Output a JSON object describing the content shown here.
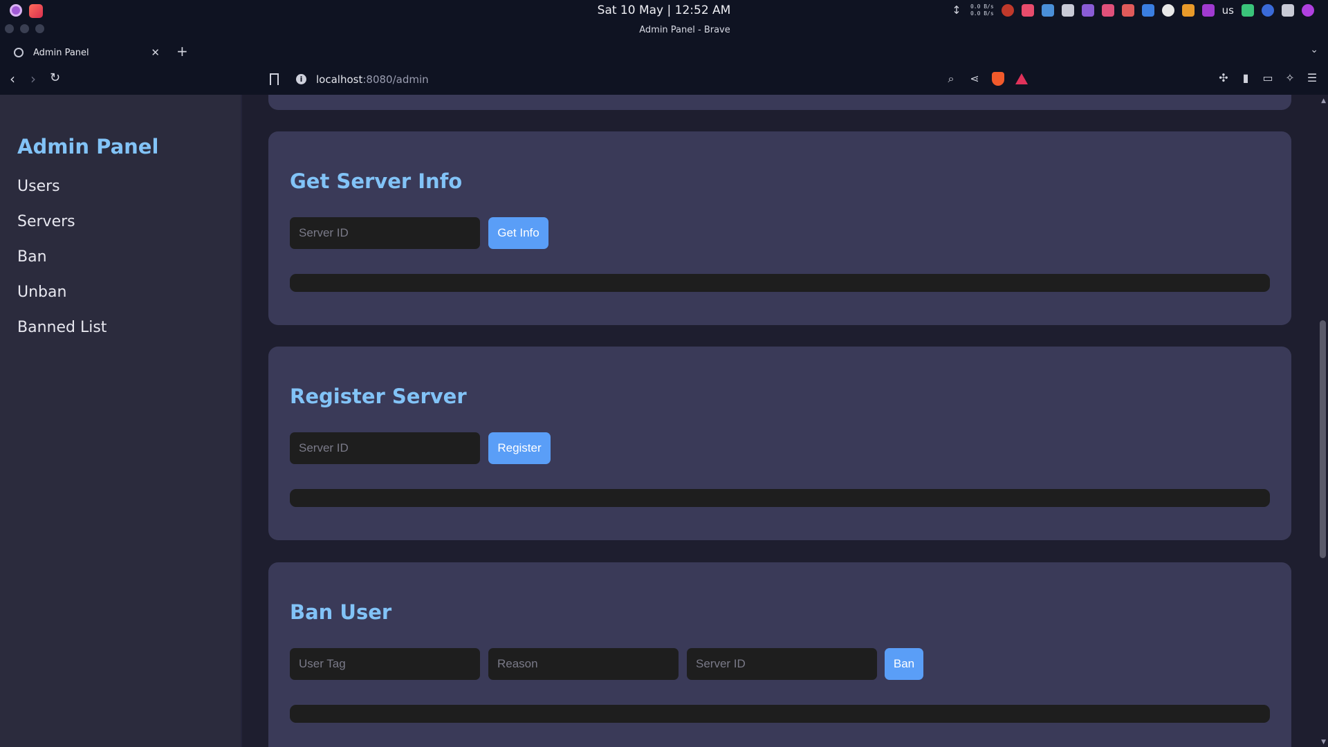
{
  "os": {
    "clock": "Sat 10 May | 12:52 AM",
    "net_up": "0.0 B/s",
    "net_down": "0.0 B/s",
    "lang": "us"
  },
  "window": {
    "title": "Admin Panel - Brave"
  },
  "browser": {
    "tab_title": "Admin Panel",
    "url_host": "localhost",
    "url_path": ":8080/admin"
  },
  "sidebar": {
    "brand": "Admin Panel",
    "items": [
      {
        "label": "Users"
      },
      {
        "label": "Servers"
      },
      {
        "label": "Ban"
      },
      {
        "label": "Unban"
      },
      {
        "label": "Banned List"
      }
    ]
  },
  "cards": {
    "server_info": {
      "title": "Get Server Info",
      "server_id_placeholder": "Server ID",
      "button": "Get Info"
    },
    "register": {
      "title": "Register Server",
      "server_id_placeholder": "Server ID",
      "button": "Register"
    },
    "ban": {
      "title": "Ban User",
      "user_tag_placeholder": "User Tag",
      "reason_placeholder": "Reason",
      "server_id_placeholder": "Server ID",
      "button": "Ban"
    }
  },
  "colors": {
    "accent": "#82c3f7",
    "button": "#5a9ef7",
    "card": "#3a3a58",
    "sidebar": "#2b2b3d",
    "page": "#1e1e2f"
  }
}
